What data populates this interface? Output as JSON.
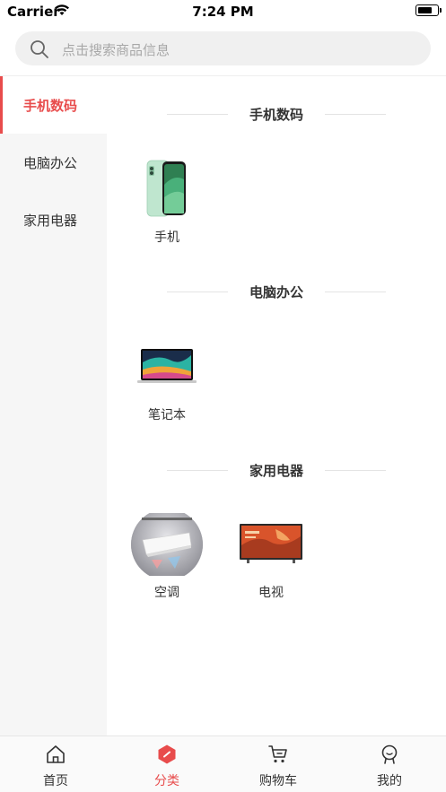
{
  "status_bar": {
    "carrier": "Carrier",
    "time": "7:24 PM"
  },
  "search": {
    "placeholder": "点击搜索商品信息"
  },
  "sidebar": {
    "items": [
      {
        "label": "手机数码",
        "active": true
      },
      {
        "label": "电脑办公",
        "active": false
      },
      {
        "label": "家用电器",
        "active": false
      }
    ]
  },
  "sections": [
    {
      "title": "手机数码",
      "products": [
        {
          "name": "手机",
          "icon": "phone-image"
        }
      ]
    },
    {
      "title": "电脑办公",
      "products": [
        {
          "name": "笔记本",
          "icon": "laptop-image"
        }
      ]
    },
    {
      "title": "家用电器",
      "products": [
        {
          "name": "空调",
          "icon": "air-conditioner-image"
        },
        {
          "name": "电视",
          "icon": "tv-image"
        }
      ]
    }
  ],
  "tabbar": {
    "items": [
      {
        "label": "首页",
        "icon": "home-icon",
        "active": false
      },
      {
        "label": "分类",
        "icon": "category-icon",
        "active": true
      },
      {
        "label": "购物车",
        "icon": "cart-icon",
        "active": false
      },
      {
        "label": "我的",
        "icon": "profile-icon",
        "active": false
      }
    ]
  },
  "colors": {
    "accent": "#e84c4c",
    "sidebar_bg": "#f6f6f6",
    "search_bg": "#f0f0f0"
  }
}
